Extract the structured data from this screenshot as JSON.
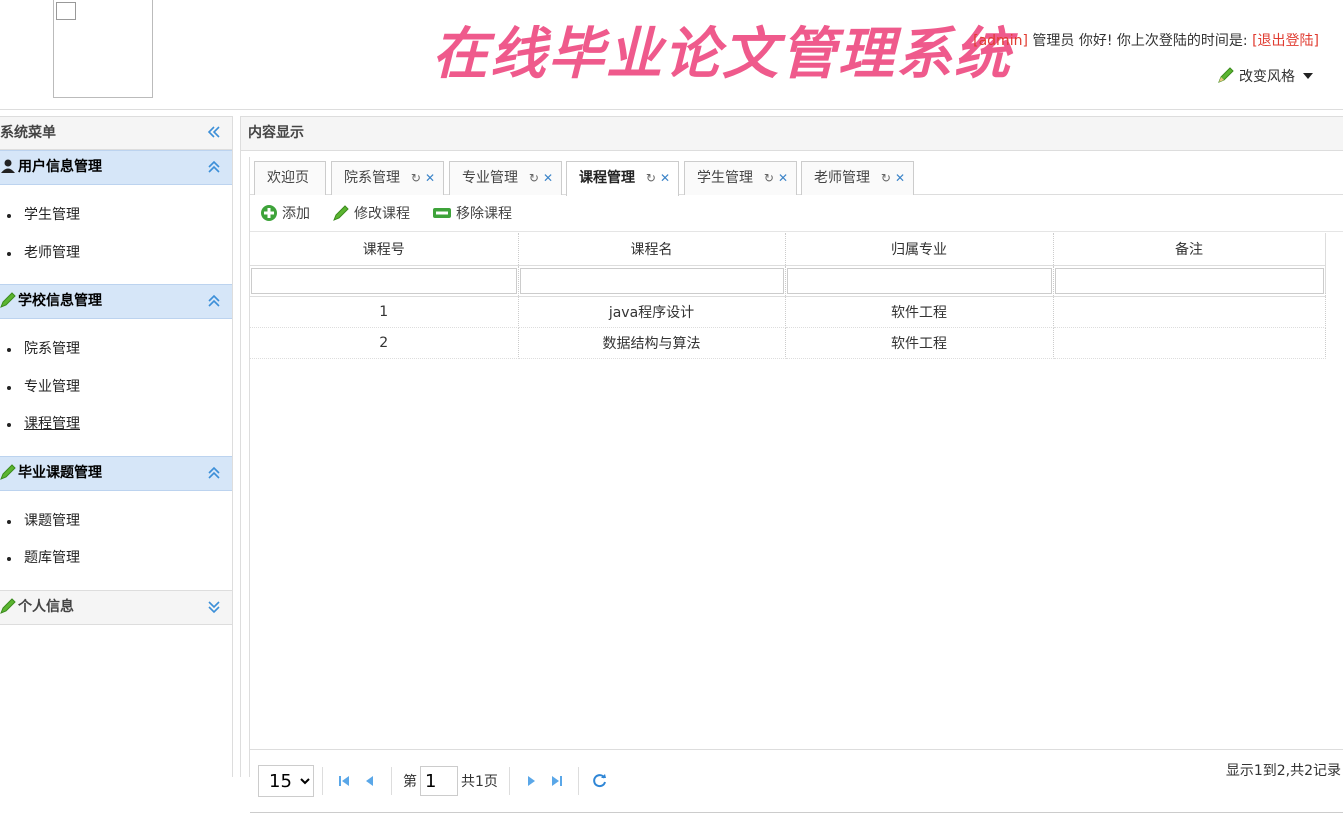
{
  "header": {
    "app_title": "在线毕业论文管理系统",
    "user_name": "[admin]",
    "greeting": " 管理员 你好! 你上次登陆的时间是: ",
    "logout": "[退出登陆]",
    "style_button": "改变风格"
  },
  "sidebar": {
    "title": "系统菜单",
    "groups": [
      {
        "title": "用户信息管理",
        "items": [
          "学生管理",
          "老师管理"
        ]
      },
      {
        "title": "学校信息管理",
        "items": [
          "院系管理",
          "专业管理",
          "课程管理"
        ]
      },
      {
        "title": "毕业课题管理",
        "items": [
          "课题管理",
          "题库管理"
        ]
      },
      {
        "title": "个人信息"
      }
    ]
  },
  "main": {
    "title": "内容显示",
    "tabs": [
      "欢迎页",
      "院系管理",
      "专业管理",
      "课程管理",
      "学生管理",
      "老师管理"
    ],
    "toolbar": {
      "add": "添加",
      "edit": "修改课程",
      "remove": "移除课程"
    },
    "table": {
      "columns": [
        "课程号",
        "课程名",
        "归属专业",
        "备注"
      ],
      "rows": [
        [
          "1",
          "java程序设计",
          "软件工程",
          ""
        ],
        [
          "2",
          "数据结构与算法",
          "软件工程",
          ""
        ]
      ]
    },
    "pager": {
      "page_size": "15",
      "page_prefix": "第",
      "page_number": "1",
      "page_total": "共1页",
      "info": "显示1到2,共2记录"
    }
  },
  "colors": {
    "title": "#ef5a8c",
    "accent": "#d6e6f8",
    "link_red": "#e03c31"
  }
}
